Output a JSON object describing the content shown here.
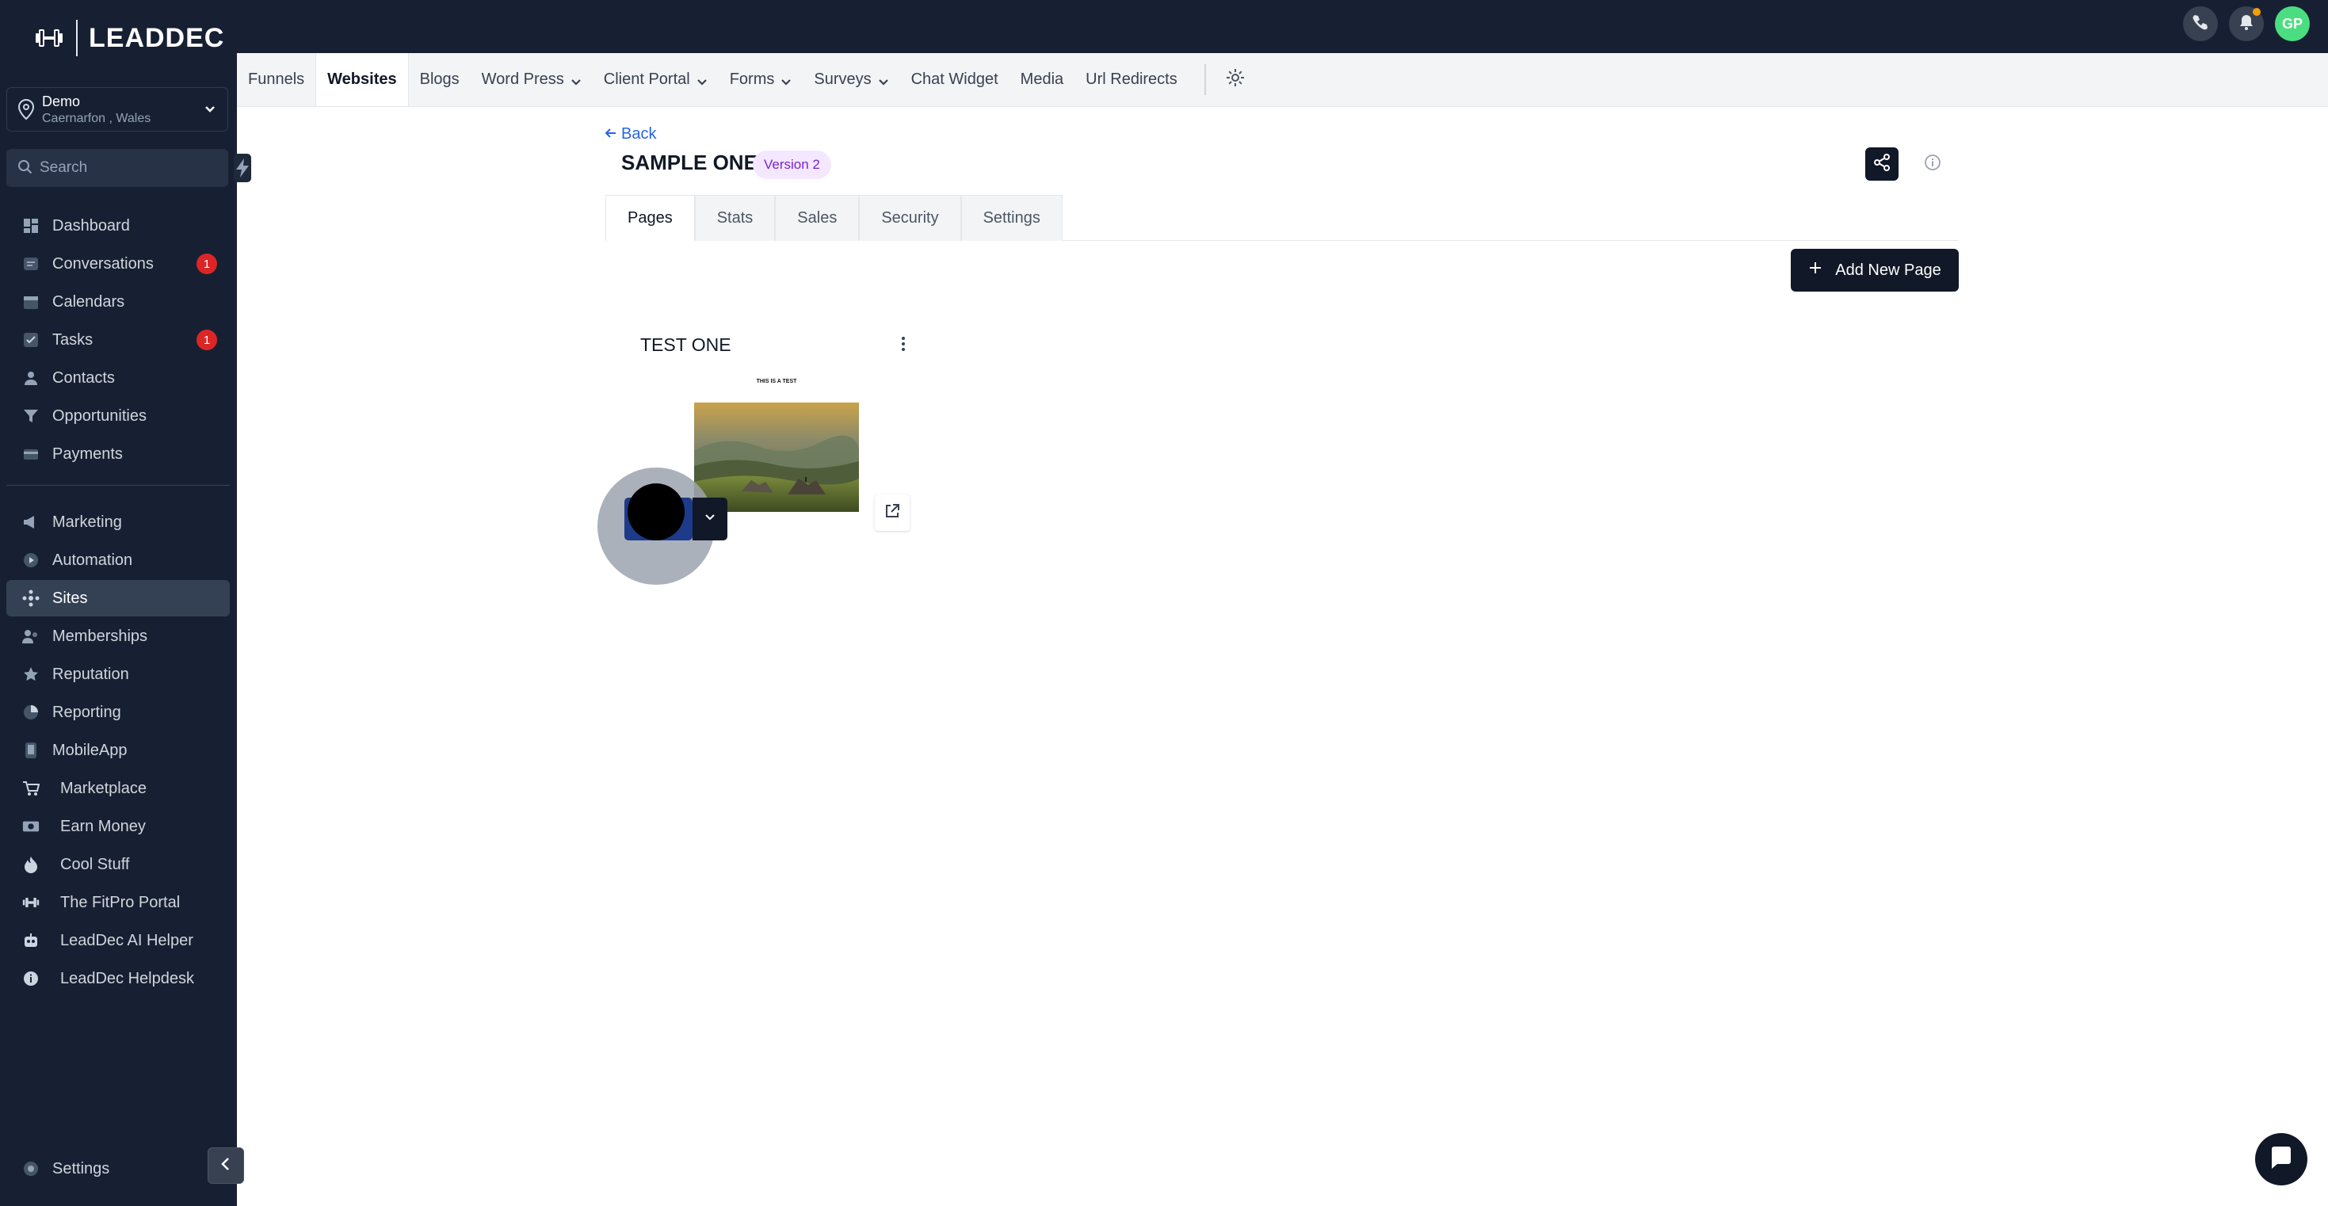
{
  "brand": {
    "name": "LEADDEC"
  },
  "location": {
    "name": "Demo",
    "address": "Caernarfon , Wales"
  },
  "search": {
    "placeholder": "Search"
  },
  "sidebar": {
    "primary": [
      {
        "label": "Dashboard",
        "icon": "dashboard-icon"
      },
      {
        "label": "Conversations",
        "icon": "chat-icon",
        "badge": "1"
      },
      {
        "label": "Calendars",
        "icon": "calendar-icon"
      },
      {
        "label": "Tasks",
        "icon": "checkbox-icon",
        "badge": "1"
      },
      {
        "label": "Contacts",
        "icon": "person-icon"
      },
      {
        "label": "Opportunities",
        "icon": "filter-icon"
      },
      {
        "label": "Payments",
        "icon": "card-icon"
      }
    ],
    "secondary": [
      {
        "label": "Marketing",
        "icon": "megaphone-icon"
      },
      {
        "label": "Automation",
        "icon": "play-icon"
      },
      {
        "label": "Sites",
        "icon": "sites-icon",
        "active": true
      },
      {
        "label": "Memberships",
        "icon": "users-icon"
      },
      {
        "label": "Reputation",
        "icon": "star-icon"
      },
      {
        "label": "Reporting",
        "icon": "pie-icon"
      },
      {
        "label": "MobileApp",
        "icon": "phone-icon"
      },
      {
        "label": "Marketplace",
        "icon": "cart-icon"
      },
      {
        "label": "Earn Money",
        "icon": "money-icon"
      },
      {
        "label": "Cool Stuff",
        "icon": "fire-icon"
      },
      {
        "label": "The FitPro Portal",
        "icon": "dumbbell-icon"
      },
      {
        "label": "LeadDec AI Helper",
        "icon": "robot-icon"
      },
      {
        "label": "LeadDec Helpdesk",
        "icon": "info-icon"
      }
    ],
    "settings_label": "Settings"
  },
  "header": {
    "avatar_initials": "GP"
  },
  "subnav": {
    "items": [
      {
        "label": "Funnels"
      },
      {
        "label": "Websites",
        "active": true
      },
      {
        "label": "Blogs"
      },
      {
        "label": "Word Press",
        "dropdown": true
      },
      {
        "label": "Client Portal",
        "dropdown": true
      },
      {
        "label": "Forms",
        "dropdown": true
      },
      {
        "label": "Surveys",
        "dropdown": true
      },
      {
        "label": "Chat Widget"
      },
      {
        "label": "Media"
      },
      {
        "label": "Url Redirects"
      }
    ]
  },
  "main": {
    "back_label": "Back",
    "title": "SAMPLE ONE",
    "version": "Version 2",
    "tabs": [
      {
        "label": "Pages",
        "active": true
      },
      {
        "label": "Stats"
      },
      {
        "label": "Sales"
      },
      {
        "label": "Security"
      },
      {
        "label": "Settings"
      }
    ],
    "add_button_label": "Add New Page",
    "pages": [
      {
        "title": "TEST ONE",
        "preview_text": "THIS IS A TEST"
      }
    ]
  },
  "colors": {
    "sidebar_bg": "#172033",
    "active_nav": "#344054",
    "badge": "#dc2626",
    "primary_button": "#111827",
    "link": "#2563eb",
    "version_badge_bg": "#f3e8ff",
    "version_badge_text": "#7e22ce"
  }
}
